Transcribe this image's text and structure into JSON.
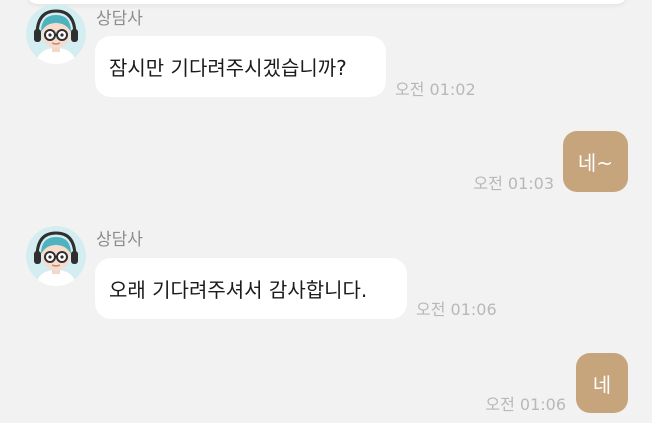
{
  "colors": {
    "background": "#f2f2f2",
    "incoming_bubble": "#ffffff",
    "outgoing_bubble": "#c6a57d",
    "sender_text": "#8d8d8d",
    "timestamp": "#b8b8b8"
  },
  "messages": [
    {
      "sender": "상담사",
      "text": "잠시만 기다려주시겠습니까?",
      "time": "오전 01:02"
    },
    {
      "text": "네~",
      "time": "오전 01:03"
    },
    {
      "sender": "상담사",
      "text": "오래 기다려주셔서 감사합니다.",
      "time": "오전 01:06"
    },
    {
      "text": "네",
      "time": "오전 01:06"
    }
  ]
}
